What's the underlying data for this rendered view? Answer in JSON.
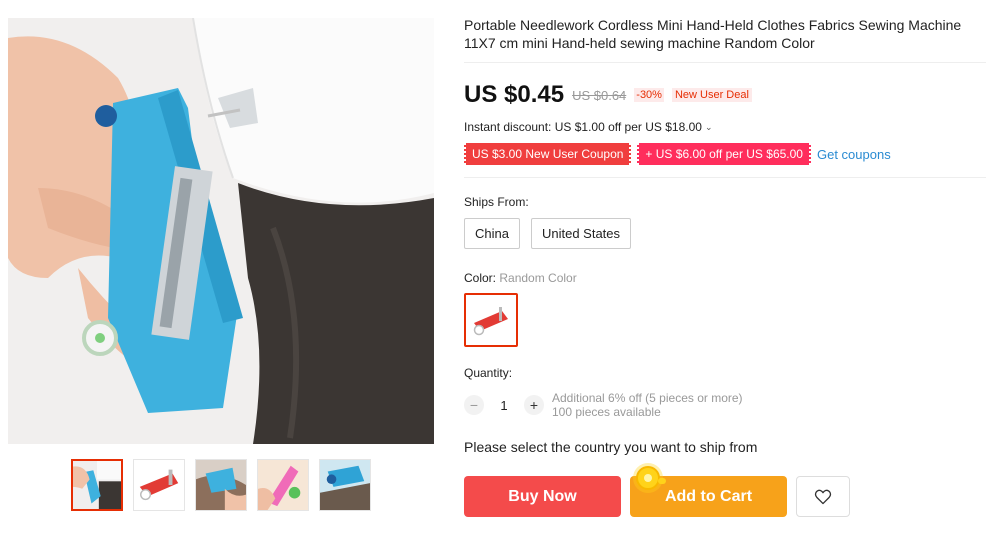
{
  "product": {
    "title": "Portable Needlework Cordless Mini Hand-Held Clothes Fabrics Sewing Machine 11X7 cm mini Hand-held sewing machine Random Color",
    "price": "US $0.45",
    "original_price": "US $0.64",
    "discount_pct": "-30%",
    "deal_badge": "New User Deal"
  },
  "promotions": {
    "instant_discount": "Instant discount: US $1.00 off per US $18.00",
    "coupons": [
      "US $3.00 New User Coupon",
      "+ US $6.00 off per US $65.00"
    ],
    "get_coupons_label": "Get coupons"
  },
  "shipping": {
    "label": "Ships From:",
    "options": [
      "China",
      "United States"
    ]
  },
  "color": {
    "label": "Color:",
    "selected": "Random Color"
  },
  "quantity": {
    "label": "Quantity:",
    "value": "1",
    "minus": "−",
    "plus": "+",
    "note_line1": "Additional 6% off (5 pieces or more)",
    "note_line2": "100 pieces available"
  },
  "ship_country_prompt": "Please select the country you want to ship from",
  "actions": {
    "buy_now": "Buy Now",
    "add_to_cart": "Add to Cart"
  },
  "gallery": {
    "thumbnail_count": 5,
    "selected_index": 0
  },
  "colors": {
    "accent_red": "#e62e04",
    "buy_now": "#f44b4b",
    "add_to_cart": "#f7a21a",
    "link": "#2a8bd2",
    "product_blue": "#3eb1de"
  },
  "icons": [
    "heart-icon",
    "chevron-down-icon",
    "coin-icon"
  ]
}
